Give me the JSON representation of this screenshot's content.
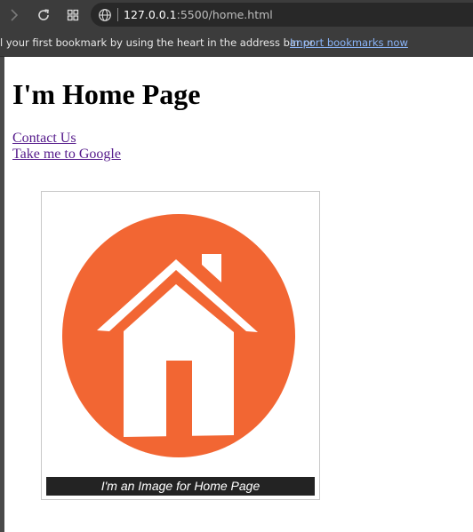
{
  "browser": {
    "url_host": "127.0.0.1",
    "url_rest": ":5500/home.html",
    "icons": {
      "forward": "forward-arrow-icon",
      "reload": "reload-icon",
      "tabs": "tab-grid-icon",
      "site": "globe-icon"
    }
  },
  "bookmarks_bar": {
    "message": "l your first bookmark by using the heart in the address bar or",
    "import_link": "Import bookmarks now"
  },
  "page": {
    "heading": "I'm Home Page",
    "links": [
      {
        "label": "Contact Us"
      },
      {
        "label": "Take me to Google"
      }
    ],
    "figure": {
      "image_icon": "house-icon",
      "caption": "I'm an Image for Home Page"
    }
  },
  "colors": {
    "toolbar_bg": "#3c3c3c",
    "visited_link": "#551a8b",
    "import_link": "#8ab4f8",
    "house_circle": "#f26633",
    "caption_bg": "#232323"
  }
}
